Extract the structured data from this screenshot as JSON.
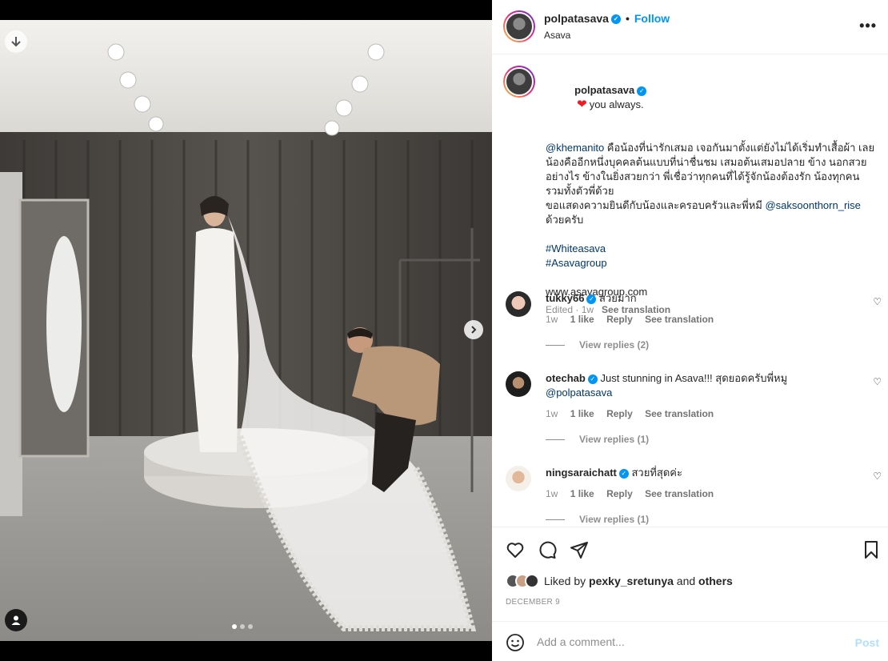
{
  "post": {
    "username": "polpatasava",
    "follow_label": "Follow",
    "location": "Asava",
    "more_label": "•••",
    "carousel": {
      "slide_count": 3,
      "active_slide": 1
    }
  },
  "caption": {
    "username": "polpatasava",
    "heart": "❤",
    "first_line": "you always.",
    "mention1": "@khemanito",
    "paragraph": " คือน้องที่น่ารักเสมอ เจอกันมาตั้งแต่ยังไม่ได้เริ่มทำเสื้อผ้า เลย น้องคืออีกหนึ่งบุคคลต้นแบบที่น่าชื่นชม เสมอต้นเสมอปลาย ข้าง นอกสวยอย่างไร ข้างในยิ่งสวยกว่า พี่เชื่อว่าทุกคนที่ได้รู้จักน้องต้องรัก น้องทุกคนรวมทั้งตัวพี่ด้วย",
    "thanks": "ขอแสดงความยินดีกับน้องและครอบครัวและพี่หมี ",
    "mention2": "@saksoonthorn_rise",
    "thanks_end": " ด้วยครับ",
    "hashtag1": "#Whiteasava",
    "hashtag2": "#Asavagroup",
    "website": "www.asavagroup.com",
    "edited": "Edited · 1w",
    "see_translation": "See translation"
  },
  "comments": [
    {
      "username": "tukky66",
      "text": "สวยมาก",
      "mention": "",
      "age": "1w",
      "likes": "1 like",
      "reply": "Reply",
      "translate": "See translation",
      "replies": "View replies (2)"
    },
    {
      "username": "otechab",
      "text": "Just stunning in Asava!!! สุดยอดครับพี่หมู",
      "mention": "@polpatasava",
      "age": "1w",
      "likes": "1 like",
      "reply": "Reply",
      "translate": "See translation",
      "replies": "View replies (1)"
    },
    {
      "username": "ningsaraichatt",
      "text": "สวยที่สุดค่ะ",
      "mention": "",
      "age": "1w",
      "likes": "1 like",
      "reply": "Reply",
      "translate": "See translation",
      "replies": "View replies (1)"
    }
  ],
  "likes": {
    "prefix": "Liked by ",
    "user": "pexky_sretunya",
    "middle": " and ",
    "others": "others"
  },
  "date": "DECEMBER 9",
  "composer": {
    "placeholder": "Add a comment...",
    "post_label": "Post"
  },
  "colors": {
    "accent": "#0095f6",
    "heart": "#ed1c24",
    "post_disabled": "#b2dffc"
  }
}
